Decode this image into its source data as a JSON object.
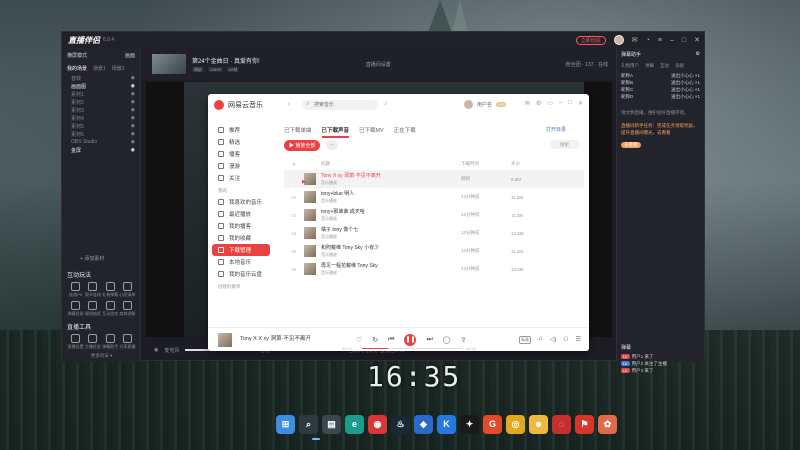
{
  "desktop": {
    "clock": "16:35",
    "taskbar_icons": [
      {
        "name": "windows-start-icon",
        "glyph": "⊞",
        "color": "#3a8ee6"
      },
      {
        "name": "search-icon",
        "glyph": "⌕",
        "color": "#2f3a3f"
      },
      {
        "name": "file-explorer-icon",
        "glyph": "▤",
        "color": "#3b4750"
      },
      {
        "name": "edge-icon",
        "glyph": "e",
        "color": "#1a9c8f"
      },
      {
        "name": "netease-music-icon",
        "glyph": "◉",
        "color": "#d93737"
      },
      {
        "name": "steam-icon",
        "glyph": "♨",
        "color": "#1b2838"
      },
      {
        "name": "store-icon",
        "glyph": "◆",
        "color": "#2a6ac9"
      },
      {
        "name": "kugou-icon",
        "glyph": "K",
        "color": "#2478e0"
      },
      {
        "name": "qq-icon",
        "glyph": "✦",
        "color": "#1a1a1a"
      },
      {
        "name": "g-app-icon",
        "glyph": "G",
        "color": "#e24b2a"
      },
      {
        "name": "chrome-icon",
        "glyph": "◎",
        "color": "#e2a81e"
      },
      {
        "name": "pet-app-icon",
        "glyph": "☻",
        "color": "#f0b83c"
      },
      {
        "name": "netease-cloud-icon",
        "glyph": "◌",
        "color": "#c62f2f"
      },
      {
        "name": "game-icon",
        "glyph": "⚑",
        "color": "#d8352a"
      },
      {
        "name": "anime-app-icon",
        "glyph": "✿",
        "color": "#e06a4a"
      }
    ]
  },
  "stream_app": {
    "logo": "直播伴侣",
    "version": "6.9.4",
    "header_pill": "立即创造",
    "header_icons": [
      "message-icon",
      "bell-icon",
      "menu-icon",
      "minimize-icon",
      "maximize-icon",
      "close-icon"
    ],
    "scene": {
      "title": "横屏模式",
      "menu": "画面",
      "tabs": [
        "我的场景",
        "场景1",
        "场景2"
      ]
    },
    "sources": [
      "音效",
      "画面图",
      "素材1",
      "素材2",
      "素材3",
      "素材4",
      "素材5",
      "素材6",
      "OBS Studio",
      "金屏"
    ],
    "add_source": "+ 添加素材",
    "interact_title": "互动玩法",
    "interact_items": [
      "连线PK",
      "观众连线",
      "礼物弹幕",
      "心愿清单",
      "弹幕投屏",
      "福袋抽奖",
      "互动游戏",
      "商城讲解"
    ],
    "tools_title": "直播工具",
    "tools_items": [
      "直播设置",
      "主播任务",
      "弹幕助手",
      "分享直播",
      "直播特效",
      "高级设置",
      "直播帮助",
      "更多功能"
    ],
    "more_tools": "更多玩法 ▾",
    "live_title": "第24个金曲日 · 真爱有你!",
    "live_tags": [
      "横屏",
      "1080P",
      "60帧"
    ],
    "live_badge": "直播间设置",
    "stats": [
      "粉丝团",
      "137",
      "在线"
    ],
    "ctrl": {
      "mic": "麦克风",
      "volume": "音量",
      "status": "当前网络良好 直播已开启"
    },
    "right_title": "弹幕助手",
    "right_tabs": [
      "礼物用户",
      "弹幕",
      "互动",
      "贡献"
    ],
    "right_rows": [
      [
        "昵称A",
        "送出小心心 ×1"
      ],
      [
        "昵称B",
        "送出小心心 ×1"
      ],
      [
        "昵称C",
        "送出小心心 ×1"
      ],
      [
        "昵称D",
        "送出小心心 ×1"
      ]
    ],
    "notice_1": "请文明直播，维护良好直播环境。",
    "notice_2": "直播间新手任务：完成任务领取奖励，提升直播间曝光，去看看",
    "notice_btn": "去看看",
    "chat_title": "弹幕",
    "chat_rows": [
      "用户1 来了",
      "用户2 关注了主播",
      "用户3 来了"
    ]
  },
  "netease": {
    "app_name": "网易云音乐",
    "search_placeholder": "搜索音乐",
    "user_name": "用户名",
    "nav": [
      {
        "label": "推荐",
        "active": false
      },
      {
        "label": "精选",
        "active": false
      },
      {
        "label": "播客",
        "active": false
      },
      {
        "label": "漫游",
        "active": false
      },
      {
        "label": "关注",
        "active": false
      }
    ],
    "my_label": "我的",
    "nav2": [
      {
        "label": "我喜欢的音乐",
        "active": false
      },
      {
        "label": "最近播放",
        "active": false
      },
      {
        "label": "我的播客",
        "active": false
      },
      {
        "label": "我的收藏",
        "active": false
      },
      {
        "label": "下载管理",
        "active": true
      },
      {
        "label": "本地音乐",
        "active": false
      },
      {
        "label": "我的音乐云盘",
        "active": false
      }
    ],
    "created_label": "创建的歌单",
    "tabs": [
      "已下载单曲",
      "已下载声音",
      "已下载MV",
      "正在下载"
    ],
    "active_tab": 1,
    "manage_link": "打开目录",
    "play_all": "▶ 播放全部",
    "find_placeholder": "搜索",
    "columns": [
      "标题",
      "下载时间",
      "大小"
    ],
    "rows": [
      {
        "idx": "01",
        "title": "Tony X xy 洞箫·不见不离开",
        "artist": "音乐播放",
        "time": "刚刚",
        "size": "6.8M",
        "playing": true
      },
      {
        "idx": "02",
        "title": "tony+blue 明人",
        "artist": "音乐播放",
        "time": "12分钟前",
        "size": "11.6M",
        "playing": false
      },
      {
        "idx": "03",
        "title": "tony+那谁谁 成天哈",
        "artist": "音乐播放",
        "time": "12分钟前",
        "size": "11.3M",
        "playing": false
      },
      {
        "idx": "04",
        "title": "橘子 tony 像个七",
        "artist": "音乐播放",
        "time": "12分钟前",
        "size": "12.8M",
        "playing": false
      },
      {
        "idx": "05",
        "title": "和煦戴维 Tony Sky 小雀少",
        "artist": "音乐播放",
        "time": "12分钟前",
        "size": "11.2M",
        "playing": false
      },
      {
        "idx": "06",
        "title": "再见一程花戴维 Tony Sky",
        "artist": "音乐播放",
        "time": "12分钟前",
        "size": "13.0M",
        "playing": false
      }
    ],
    "player": {
      "song": "X xy 洞箫·不见不离开",
      "artist": "Tony X",
      "time_now": "00:42",
      "time_total": "02:41",
      "progress": 0.26,
      "quality": "标准"
    }
  }
}
